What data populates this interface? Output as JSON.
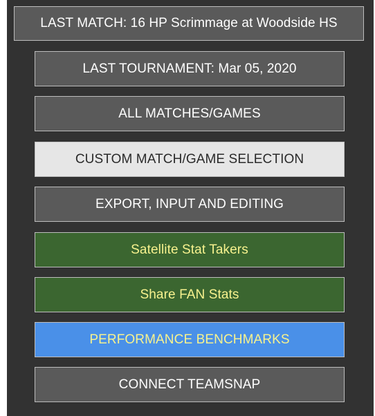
{
  "menu": {
    "last_match": "LAST MATCH: 16 HP Scrimmage at Woodside HS",
    "last_tournament": "LAST TOURNAMENT: Mar 05, 2020",
    "all_matches": "ALL MATCHES/GAMES",
    "custom_selection": "CUSTOM MATCH/GAME SELECTION",
    "export_input_editing": "EXPORT, INPUT AND EDITING",
    "satellite_stat_takers": "Satellite Stat Takers",
    "share_fan_stats": "Share FAN Stats",
    "performance_benchmarks": "PERFORMANCE BENCHMARKS",
    "connect_teamsnap": "CONNECT TEAMSNAP"
  },
  "colors": {
    "panel_background": "#323232",
    "gray_button": "#5a5a5a",
    "selected_button": "#e6e6e6",
    "green_button": "#3b6630",
    "blue_button": "#4a90e8",
    "highlight_text": "#f7f28e"
  }
}
